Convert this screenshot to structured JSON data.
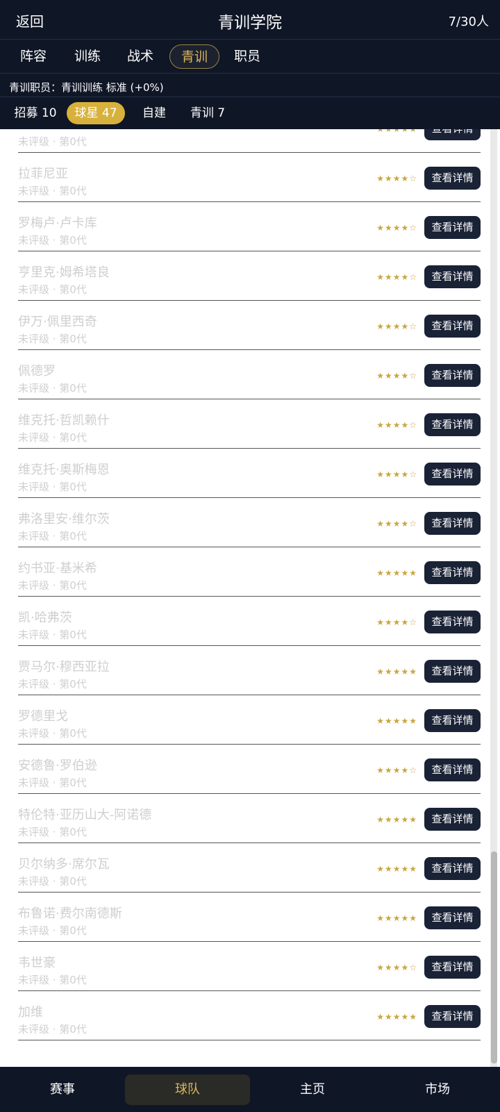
{
  "header": {
    "back_label": "返回",
    "title": "青训学院",
    "count": "7/30人"
  },
  "tabs": [
    {
      "label": "阵容",
      "active": false
    },
    {
      "label": "训练",
      "active": false
    },
    {
      "label": "战术",
      "active": false
    },
    {
      "label": "青训",
      "active": true
    },
    {
      "label": "职员",
      "active": false
    }
  ],
  "staff_line": "青训职员：青训训练 标准 (+0%)",
  "subtabs": [
    {
      "label": "招募 10",
      "active": false
    },
    {
      "label": "球星 47",
      "active": true
    },
    {
      "label": "自建",
      "active": false
    },
    {
      "label": "青训 7",
      "active": false
    }
  ],
  "list": {
    "detail_label": "查看详情",
    "sub_label": "未评级 · 第0代",
    "players": [
      {
        "name": "",
        "rating": 5
      },
      {
        "name": "拉菲尼亚",
        "rating": 4
      },
      {
        "name": "罗梅卢·卢卡库",
        "rating": 4
      },
      {
        "name": "亨里克·姆希塔良",
        "rating": 4
      },
      {
        "name": "伊万·佩里西奇",
        "rating": 4
      },
      {
        "name": "佩德罗",
        "rating": 4
      },
      {
        "name": "维克托·哲凯赖什",
        "rating": 4
      },
      {
        "name": "维克托·奥斯梅恩",
        "rating": 4
      },
      {
        "name": "弗洛里安·维尔茨",
        "rating": 4
      },
      {
        "name": "约书亚·基米希",
        "rating": 5
      },
      {
        "name": "凯·哈弗茨",
        "rating": 4
      },
      {
        "name": "贾马尔·穆西亚拉",
        "rating": 5
      },
      {
        "name": "罗德里戈",
        "rating": 5
      },
      {
        "name": "安德鲁·罗伯逊",
        "rating": 4
      },
      {
        "name": "特伦特·亚历山大-阿诺德",
        "rating": 5
      },
      {
        "name": "贝尔纳多·席尔瓦",
        "rating": 5
      },
      {
        "name": "布鲁诺·费尔南德斯",
        "rating": 5
      },
      {
        "name": "韦世豪",
        "rating": 4
      },
      {
        "name": "加维",
        "rating": 5
      }
    ]
  },
  "bottom_nav": [
    {
      "label": "赛事",
      "active": false
    },
    {
      "label": "球队",
      "active": true
    },
    {
      "label": "主页",
      "active": false
    },
    {
      "label": "市场",
      "active": false
    }
  ],
  "colors": {
    "bar_bg": "#0f1626",
    "accent_gold": "#d7b13c",
    "star": "#c9a640",
    "button_bg": "#1a2236"
  }
}
